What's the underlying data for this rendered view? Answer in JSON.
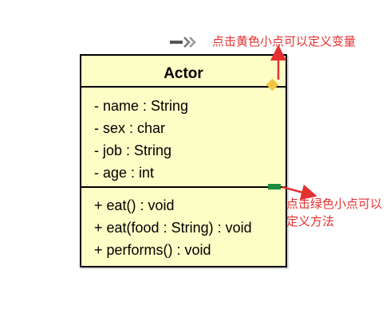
{
  "class": {
    "name": "Actor",
    "attributes": [
      "- name : String",
      "- sex : char",
      "- job : String",
      "- age : int"
    ],
    "operations": [
      "+ eat() : void",
      "+ eat(food : String) : void",
      "+ performs() : void"
    ]
  },
  "annotations": {
    "yellow_note": "点击黄色小点可以定义变量",
    "green_note": "点击绿色小点可以定义方法"
  },
  "colors": {
    "class_fill": "#fdfdc6",
    "yellow_handle": "#f5c542",
    "green_handle": "#1b8a3a",
    "annotation": "#e53030"
  },
  "icons": {
    "drag_handle": "double-chevron-right-icon"
  }
}
